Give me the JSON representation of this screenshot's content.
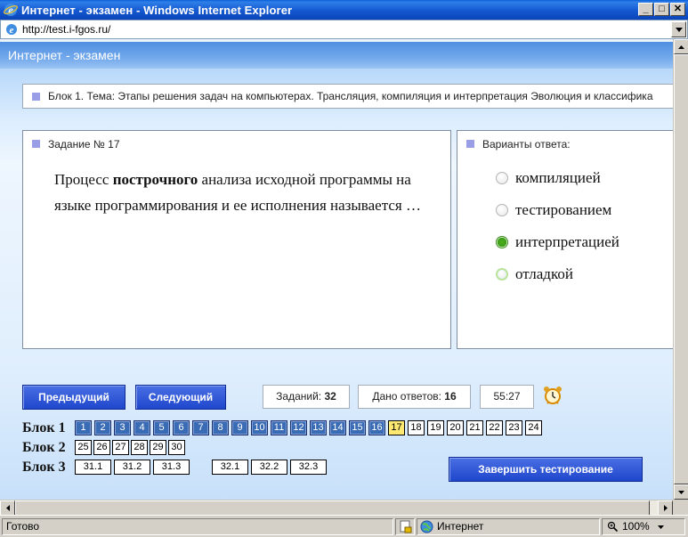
{
  "window": {
    "title": "Интернет - экзамен - Windows Internet Explorer",
    "minimize": "_",
    "maximize": "□",
    "close": "✕"
  },
  "address": {
    "url": "http://test.i-fgos.ru/"
  },
  "page": {
    "header_title": "Интернет - экзамен",
    "block_topic": "Блок 1. Тема: Этапы решения задач на компьютерах. Трансляция, компиляция и интерпретация Эволюция и классифика",
    "task": {
      "number_label": "Задание № 17",
      "question_part1": "Процесс ",
      "question_bold": "построчного",
      "question_part2": " анализа исходной программы на языке программирования и ее исполнения называется …"
    },
    "answers": {
      "title": "Варианты ответа:",
      "options": [
        {
          "label": "компиляцией",
          "state": "unchecked"
        },
        {
          "label": "тестированием",
          "state": "unchecked"
        },
        {
          "label": "интерпретацией",
          "state": "checked"
        },
        {
          "label": "отладкой",
          "state": "focused"
        }
      ]
    },
    "nav": {
      "prev_label": "Предыдущий",
      "next_label": "Следующий",
      "tasks_label": "Заданий:",
      "tasks_count": "32",
      "answered_label": "Дано ответов:",
      "answered_count": "16",
      "timer": "55:27",
      "alarm_icon": "alarm-clock-icon"
    },
    "blocks": [
      {
        "label": "Блок 1",
        "cells": [
          "1",
          "2",
          "3",
          "4",
          "5",
          "6",
          "7",
          "8",
          "9",
          "10",
          "11",
          "12",
          "13",
          "14",
          "15",
          "16",
          "17",
          "18",
          "19",
          "20",
          "21",
          "22",
          "23",
          "24"
        ],
        "answered_until": 16,
        "current": "17"
      },
      {
        "label": "Блок 2",
        "cells": [
          "25",
          "26",
          "27",
          "28",
          "29",
          "30"
        ]
      },
      {
        "label": "Блок 3",
        "cells": [
          "31.1",
          "31.2",
          "31.3",
          "32.1",
          "32.2",
          "32.3"
        ]
      }
    ],
    "finish_label": "Завершить тестирование"
  },
  "status": {
    "text": "Готово",
    "zone": "Интернет",
    "zoom": "100%"
  },
  "colors": {
    "answered_cell": "#3a6bb5",
    "current_cell": "#fde972",
    "button": "#1f47cc",
    "header": "#4f8fe0"
  }
}
